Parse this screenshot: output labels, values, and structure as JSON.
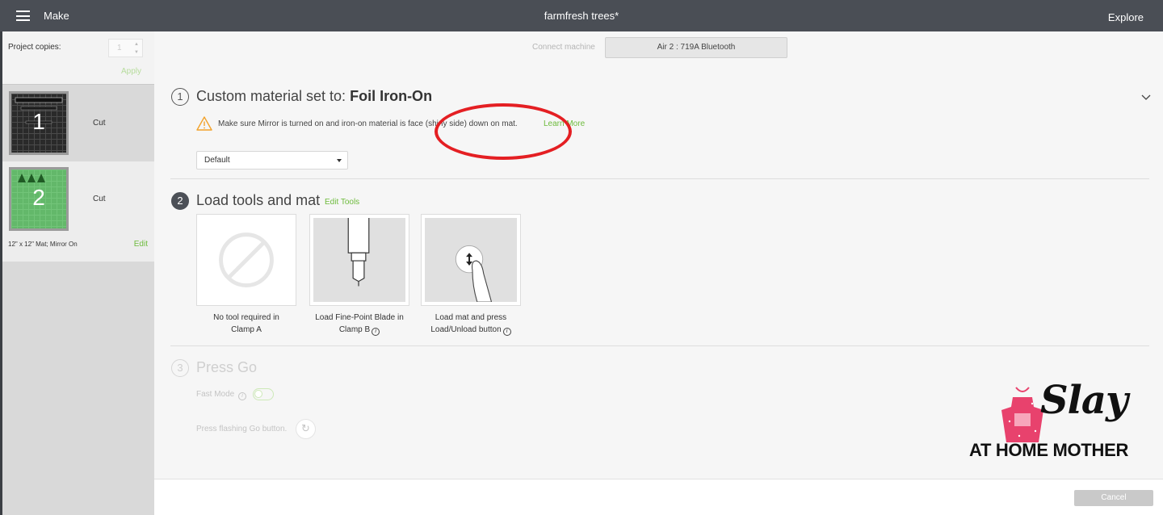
{
  "header": {
    "menu_label": "Make",
    "document_title": "farmfresh trees*",
    "explore_label": "Explore"
  },
  "sidebar": {
    "project_copies_label": "Project copies:",
    "project_copies_value": "1",
    "apply_label": "Apply",
    "mats": [
      {
        "number": "1",
        "action": "Cut",
        "thumb_color": "#2a2a2a"
      },
      {
        "number": "2",
        "action": "Cut",
        "thumb_color": "#63b86a",
        "description": "12\" x 12\" Mat; Mirror On",
        "edit_label": "Edit"
      }
    ]
  },
  "connect": {
    "label": "Connect machine",
    "machine": "Air 2 : 719A Bluetooth"
  },
  "step1": {
    "number": "1",
    "title_prefix": "Custom material set to:",
    "material": "Foil Iron-On",
    "warning": "Make sure Mirror is turned on and iron-on material is face (shiny side) down on mat.",
    "learn_more": "Learn More",
    "pressure_value": "Default"
  },
  "step2": {
    "number": "2",
    "title": "Load tools and mat",
    "edit_tools": "Edit Tools",
    "cards": [
      {
        "caption_line1": "No tool required in",
        "caption_line2": "Clamp A",
        "icon": "no-tool-icon"
      },
      {
        "caption_line1": "Load Fine-Point Blade in",
        "caption_line2": "Clamp B",
        "icon": "fine-point-blade-icon"
      },
      {
        "caption_line1": "Load mat and press",
        "caption_line2": "Load/Unload button",
        "icon": "load-unload-button-icon"
      }
    ]
  },
  "step3": {
    "number": "3",
    "title": "Press Go",
    "fast_mode_label": "Fast Mode",
    "fast_mode_on": false,
    "go_instruction": "Press flashing Go button."
  },
  "footer": {
    "cancel_label": "Cancel"
  },
  "watermark": {
    "line1": "Slay",
    "line2": "AT HOME MOTHER"
  },
  "colors": {
    "topbar": "#4a4e55",
    "accent_green": "#6dbb3c",
    "annotation_red": "#e41f23"
  }
}
